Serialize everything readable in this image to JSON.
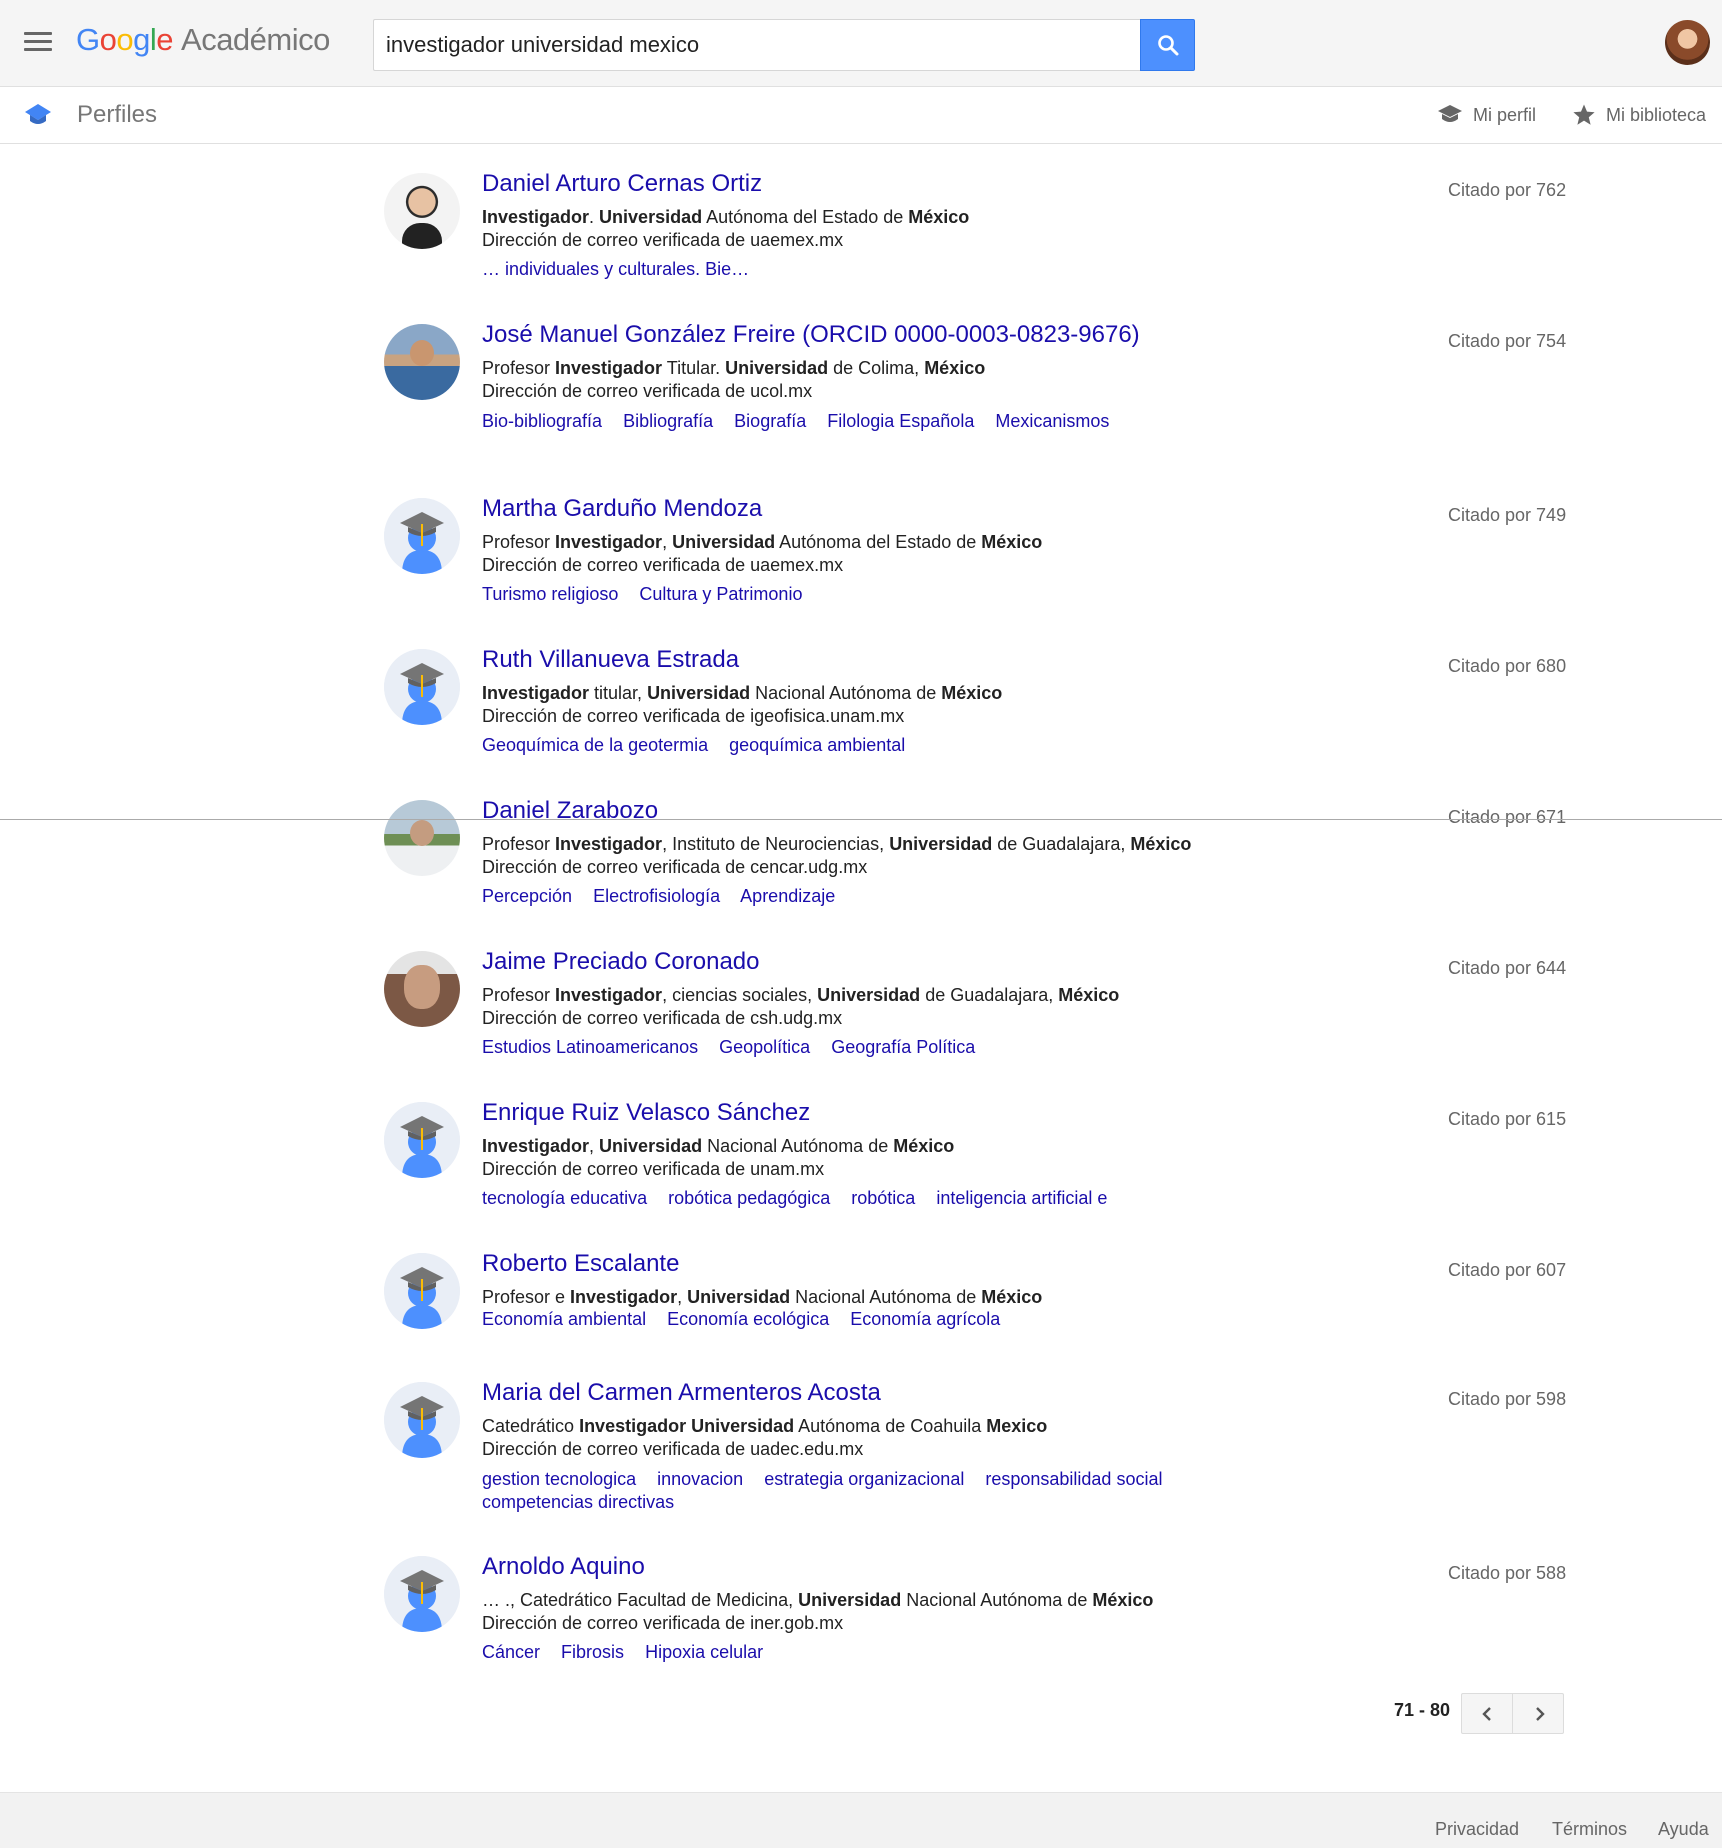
{
  "header": {
    "logo_google": [
      "G",
      "o",
      "o",
      "g",
      "l",
      "e"
    ],
    "logo_suffix": "Académico",
    "search_value": "investigador universidad mexico"
  },
  "subbar": {
    "title": "Perfiles",
    "my_profile": "Mi perfil",
    "my_library": "Mi biblioteca"
  },
  "results": [
    {
      "name": "Daniel Arturo Cernas Ortiz",
      "affiliation_html": "<b>Investigador</b>. <b>Universidad</b> Autónoma del Estado de <b>México</b>",
      "email": "Dirección de correo verificada de uaemex.mx",
      "interests": [
        "… individuales y culturales. Bie…"
      ],
      "cited": "Citado por 762",
      "photo": "real1"
    },
    {
      "name": "José Manuel González Freire (ORCID 0000-0003-0823-9676)",
      "affiliation_html": "Profesor <b>Investigador</b> Titular. <b>Universidad</b> de Colima, <b>México</b>",
      "email": "Dirección de correo verificada de ucol.mx",
      "interests": [
        "Bio-bibliografía",
        "Bibliografía",
        "Biografía",
        "Filologia Española",
        "Mexicanismos"
      ],
      "cited": "Citado por 754",
      "photo": "real2"
    },
    {
      "name": "Martha Garduño Mendoza",
      "affiliation_html": "Profesor <b>Investigador</b>, <b>Universidad</b> Autónoma del Estado de <b>México</b>",
      "email": "Dirección de correo verificada de uaemex.mx",
      "interests": [
        "Turismo religioso",
        "Cultura y Patrimonio"
      ],
      "cited": "Citado por 749",
      "photo": "placeholder"
    },
    {
      "name": "Ruth Villanueva Estrada",
      "affiliation_html": "<b>Investigador</b> titular, <b>Universidad</b> Nacional Autónoma de <b>México</b>",
      "email": "Dirección de correo verificada de igeofisica.unam.mx",
      "interests": [
        "Geoquímica de la geotermia",
        "geoquímica ambiental"
      ],
      "cited": "Citado por 680",
      "photo": "placeholder"
    },
    {
      "name": "Daniel Zarabozo",
      "affiliation_html": "Profesor <b>Investigador</b>, Instituto de Neurociencias, <b>Universidad</b> de Guadalajara, <b>México</b>",
      "email": "Dirección de correo verificada de cencar.udg.mx",
      "interests": [
        "Percepción",
        "Electrofisiología",
        "Aprendizaje"
      ],
      "cited": "Citado por 671",
      "photo": "real3"
    },
    {
      "name": "Jaime Preciado Coronado",
      "affiliation_html": "Profesor <b>Investigador</b>, ciencias sociales, <b>Universidad</b> de Guadalajara, <b>México</b>",
      "email": "Dirección de correo verificada de csh.udg.mx",
      "interests": [
        "Estudios Latinoamericanos",
        "Geopolítica",
        "Geografía Política"
      ],
      "cited": "Citado por 644",
      "photo": "real4"
    },
    {
      "name": "Enrique Ruiz Velasco Sánchez",
      "affiliation_html": "<b>Investigador</b>, <b>Universidad</b> Nacional Autónoma de <b>México</b>",
      "email": "Dirección de correo verificada de unam.mx",
      "interests": [
        "tecnología educativa",
        "robótica pedagógica",
        "robótica",
        "inteligencia artificial e"
      ],
      "cited": "Citado por 615",
      "photo": "placeholder"
    },
    {
      "name": "Roberto Escalante",
      "affiliation_html": "Profesor e <b>Investigador</b>, <b>Universidad</b> Nacional Autónoma de <b>México</b>",
      "email": "",
      "interests": [
        "Economía ambiental",
        "Economía ecológica",
        "Economía agrícola"
      ],
      "cited": "Citado por 607",
      "photo": "placeholder"
    },
    {
      "name": "Maria del Carmen Armenteros Acosta",
      "affiliation_html": "Catedrático <b>Investigador Universidad</b> Autónoma de Coahuila <b>Mexico</b>",
      "email": "Dirección de correo verificada de uadec.edu.mx",
      "interests": [
        "gestion tecnologica",
        "innovacion",
        "estrategia organizacional",
        "responsabilidad social",
        "competencias directivas"
      ],
      "cited": "Citado por 598",
      "photo": "placeholder"
    },
    {
      "name": "Arnoldo Aquino",
      "affiliation_html": "… ., Catedrático Facultad de Medicina, <b>Universidad</b> Nacional Autónoma de <b>México</b>",
      "email": "Dirección de correo verificada de iner.gob.mx",
      "interests": [
        "Cáncer",
        "Fibrosis",
        "Hipoxia celular"
      ],
      "cited": "Citado por 588",
      "photo": "placeholder"
    }
  ],
  "pager": {
    "range": "71 - 80"
  },
  "footer": {
    "privacy": "Privacidad",
    "terms": "Términos",
    "help": "Ayuda"
  },
  "colors": {
    "link": "#1a0dab",
    "search_button": "#4d90fe",
    "placeholder_figure": "#4d90fe",
    "placeholder_cap": "#757575"
  }
}
